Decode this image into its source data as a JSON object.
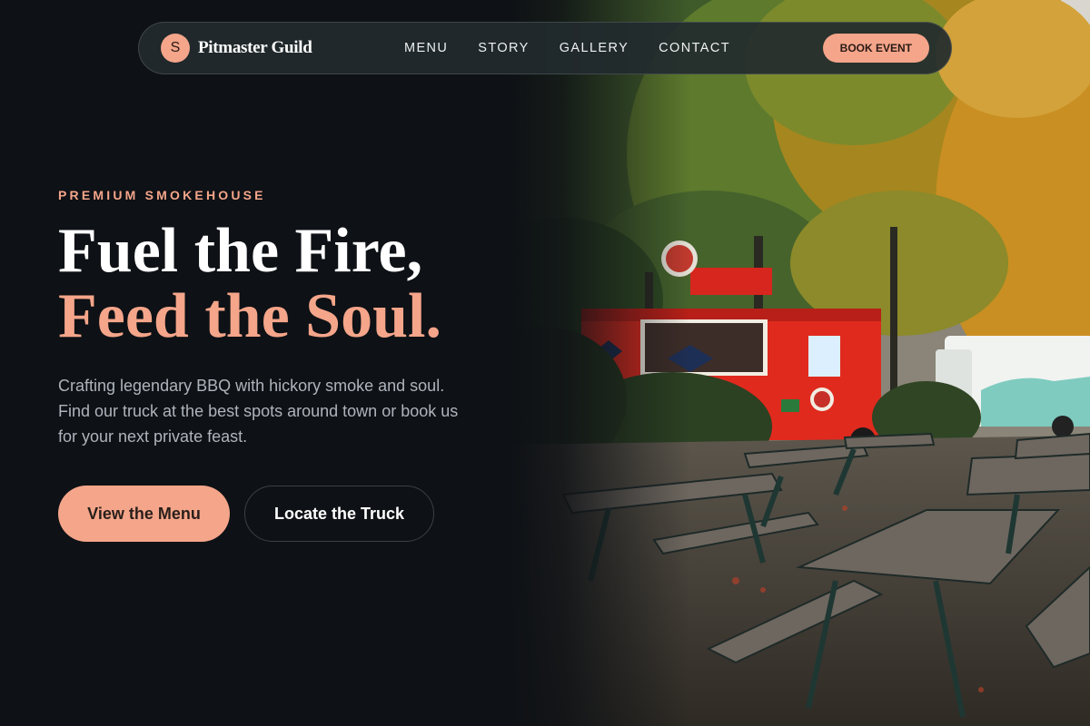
{
  "nav": {
    "brand_initial": "S",
    "brand_name": "Pitmaster Guild",
    "links": [
      "MENU",
      "STORY",
      "GALLERY",
      "CONTACT"
    ],
    "cta": "BOOK EVENT"
  },
  "hero": {
    "eyebrow": "PREMIUM SMOKEHOUSE",
    "headline_line1": "Fuel the Fire,",
    "headline_line2": "Feed the Soul.",
    "lede": "Crafting legendary BBQ with hickory smoke and soul. Find our truck at the best spots around town or book us for your next private feast.",
    "primary_button": "View the Menu",
    "secondary_button": "Locate the Truck"
  },
  "colors": {
    "background": "#0e1115",
    "accent": "#f4a58a",
    "nav_bg": "#222a2e",
    "text_muted": "#aeb4bc"
  },
  "icons": {
    "brand_mark": "brand-logo-icon"
  }
}
